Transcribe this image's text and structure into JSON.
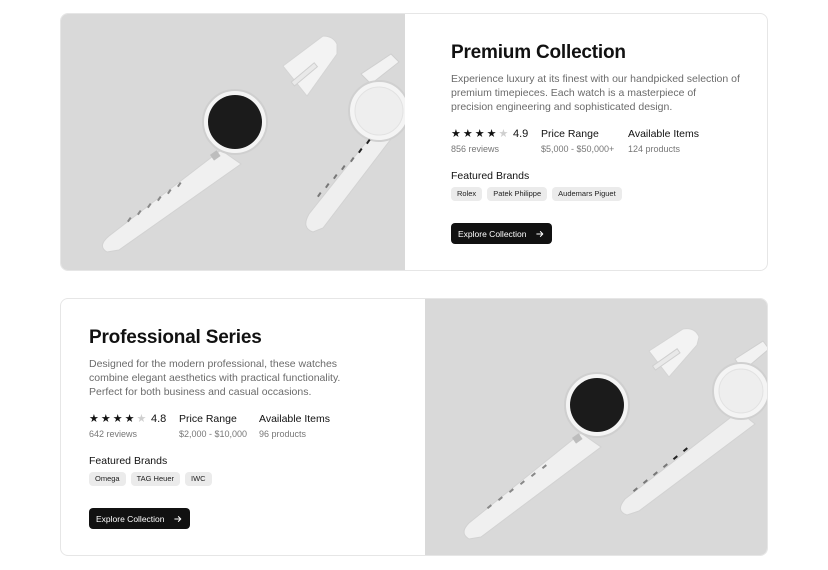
{
  "collections": [
    {
      "title": "Premium Collection",
      "description": "Experience luxury at its finest with our handpicked selection of premium timepieces. Each watch is a masterpiece of precision engineering and sophisticated design.",
      "rating": {
        "value": "4.9",
        "stars": 4,
        "max_stars": 5,
        "reviews": "856 reviews"
      },
      "price": {
        "label": "Price Range",
        "value": "$5,000 - $50,000+"
      },
      "availability": {
        "label": "Available Items",
        "value": "124 products"
      },
      "brands_title": "Featured Brands",
      "brands": [
        "Rolex",
        "Patek Philippe",
        "Audemars Piguet"
      ],
      "button_label": "Explore Collection",
      "image": "white-smartwatch-product-photo",
      "image_side": "left"
    },
    {
      "title": "Professional Series",
      "description": "Designed for the modern professional, these watches combine elegant aesthetics with practical functionality. Perfect for both business and casual occasions.",
      "rating": {
        "value": "4.8",
        "stars": 4,
        "max_stars": 5,
        "reviews": "642 reviews"
      },
      "price": {
        "label": "Price Range",
        "value": "$2,000 - $10,000"
      },
      "availability": {
        "label": "Available Items",
        "value": "96 products"
      },
      "brands_title": "Featured Brands",
      "brands": [
        "Omega",
        "TAG Heuer",
        "IWC"
      ],
      "button_label": "Explore Collection",
      "image": "white-smartwatch-product-photo",
      "image_side": "right"
    }
  ],
  "icons": {
    "star": "star-icon",
    "arrow": "arrow-right-icon"
  },
  "colors": {
    "button_bg": "#111111",
    "image_bg": "#d9d9d9",
    "tag_bg": "#ebebeb",
    "muted_text": "#6b6b6b"
  }
}
